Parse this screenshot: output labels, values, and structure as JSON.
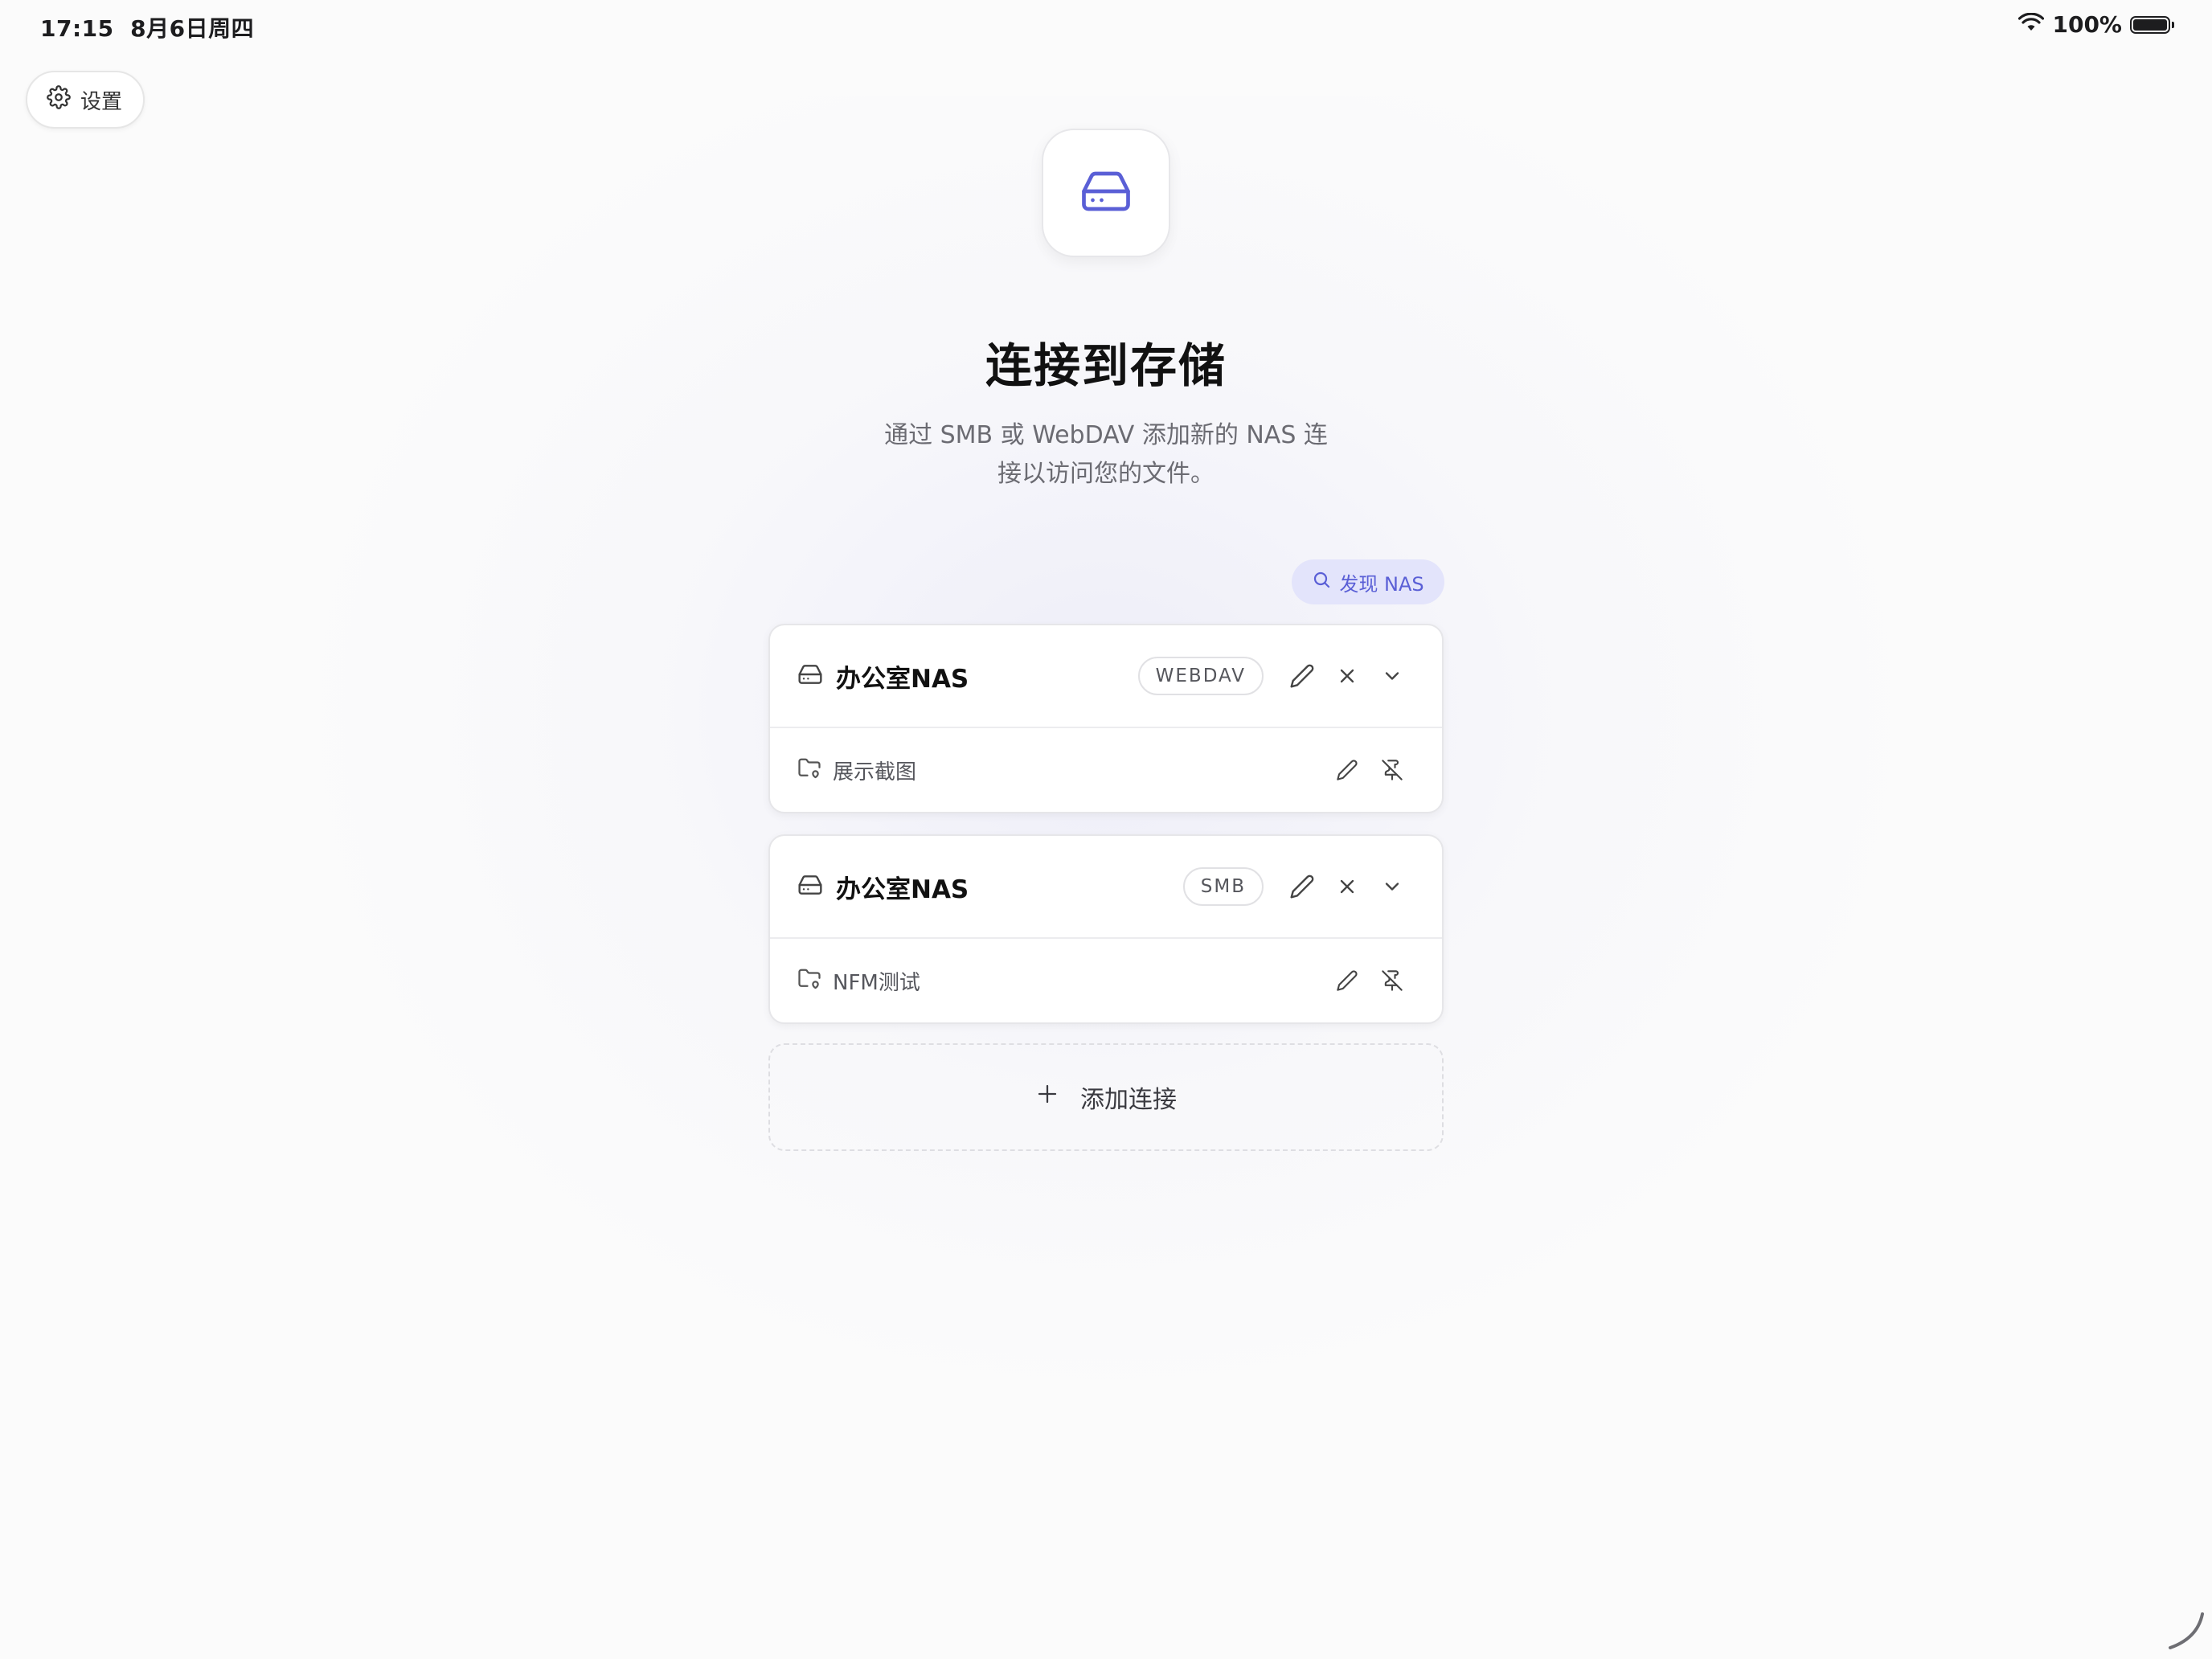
{
  "status_bar": {
    "time": "17:15",
    "date": "8月6日周四",
    "battery": "100%",
    "wifi_icon": "wifi-icon"
  },
  "settings": {
    "label": "设置",
    "icon": "gear-icon"
  },
  "hero": {
    "icon": "drive-icon",
    "title": "连接到存储",
    "subtitle": "通过 SMB 或 WebDAV 添加新的 NAS 连接以访问您的文件。"
  },
  "discover": {
    "label": "发现 NAS",
    "icon": "search-icon"
  },
  "connections": [
    {
      "name": "办公室NAS",
      "protocol": "WEBDAV",
      "folder": "展示截图"
    },
    {
      "name": "办公室NAS",
      "protocol": "SMB",
      "folder": "NFM测试"
    }
  ],
  "add_connection": {
    "label": "添加连接",
    "icon": "plus-icon"
  },
  "colors": {
    "accent": "#5a5fd6",
    "accent_bg": "#e3e4fb",
    "background": "#fbfbfb"
  }
}
